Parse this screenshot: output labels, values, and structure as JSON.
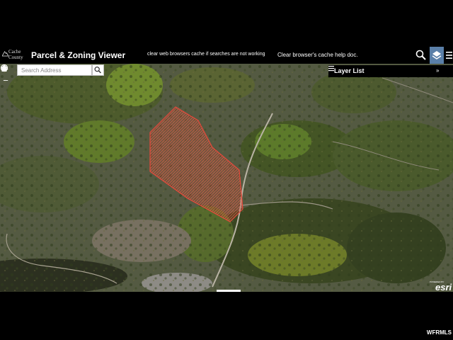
{
  "header": {
    "logo_line1": "Cache",
    "logo_line2": "County",
    "title": "Parcel & Zoning Viewer",
    "cache_message": "clear web browsers cache if searches are not working",
    "cache_link": "Clear browser's cache help doc.",
    "icons": [
      "search-icon",
      "layers-icon",
      "menu-icon"
    ]
  },
  "map": {
    "zoom_in": "+",
    "zoom_out": "−",
    "search": {
      "placeholder": "Search Address"
    },
    "layer_panel": {
      "title": "Layer List",
      "collapse": "»"
    },
    "attribution": {
      "powered_by": "POWERED BY",
      "logo": "esri"
    },
    "parcel_color": "#e64a3c"
  },
  "watermark": "WFRMLS",
  "colors": {
    "toolbar_bg": "#000000",
    "active_tool": "#5a7fa8"
  }
}
